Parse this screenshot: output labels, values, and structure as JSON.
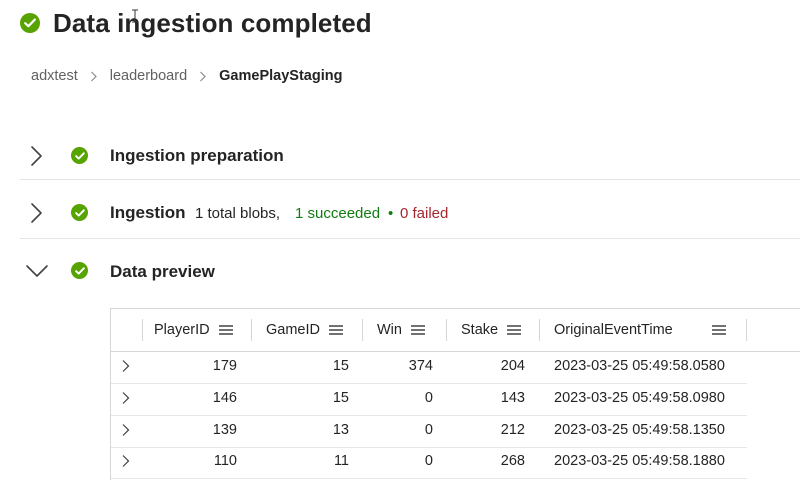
{
  "page": {
    "title": "Data ingestion completed",
    "colors": {
      "success": "#57a300",
      "success_text": "#107c10",
      "failed_text": "#a4262c",
      "muted": "#616161"
    }
  },
  "breadcrumb": {
    "items": [
      "adxtest",
      "leaderboard",
      "GamePlayStaging"
    ]
  },
  "sections": [
    {
      "title": "Ingestion preparation",
      "expanded": false,
      "status_icon": "check-circle-icon"
    },
    {
      "title": "Ingestion",
      "expanded": false,
      "status_icon": "check-circle-icon",
      "summary": {
        "total": "1 total blobs,",
        "succeeded": "1 succeeded",
        "bullet": "•",
        "failed": "0 failed"
      }
    },
    {
      "title": "Data preview",
      "expanded": true,
      "status_icon": "check-circle-icon"
    }
  ],
  "grid": {
    "columns": [
      "PlayerID",
      "GameID",
      "Win",
      "Stake",
      "OriginalEventTime"
    ],
    "rows": [
      [
        "179",
        "15",
        "374",
        "204",
        "2023-03-25 05:49:58.0580"
      ],
      [
        "146",
        "15",
        "0",
        "143",
        "2023-03-25 05:49:58.0980"
      ],
      [
        "139",
        "13",
        "0",
        "212",
        "2023-03-25 05:49:58.1350"
      ],
      [
        "110",
        "11",
        "0",
        "268",
        "2023-03-25 05:49:58.1880"
      ]
    ]
  }
}
